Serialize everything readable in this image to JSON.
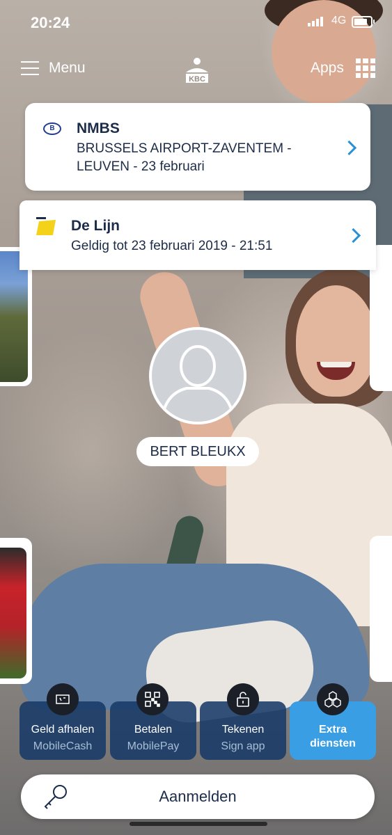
{
  "status_bar": {
    "time": "20:24",
    "network": "4G"
  },
  "nav": {
    "menu_label": "Menu",
    "apps_label": "Apps",
    "logo_text": "KBC"
  },
  "tickets": [
    {
      "title": "NMBS",
      "line1": "BRUSSELS AIRPORT-ZAVENTEM -",
      "line2": "LEUVEN - 23 februari",
      "logo": "B"
    },
    {
      "title": "De Lijn",
      "line1": "Geldig tot 23 februari 2019 - 21:51"
    }
  ],
  "profile": {
    "name": "BERT BLEUKX"
  },
  "actions": [
    {
      "label": "Geld afhalen",
      "sub": "MobileCash",
      "icon": "atm-icon"
    },
    {
      "label": "Betalen",
      "sub": "MobilePay",
      "icon": "qr-code-icon"
    },
    {
      "label": "Tekenen",
      "sub": "Sign app",
      "icon": "unlock-icon"
    },
    {
      "label": "Extra",
      "sub": "diensten",
      "icon": "hexagons-icon"
    }
  ],
  "login": {
    "label": "Aanmelden"
  },
  "colors": {
    "brand_dark": "#1c2c49",
    "accent_blue": "#3a9ee4",
    "chevron_blue": "#2b8fd6"
  }
}
